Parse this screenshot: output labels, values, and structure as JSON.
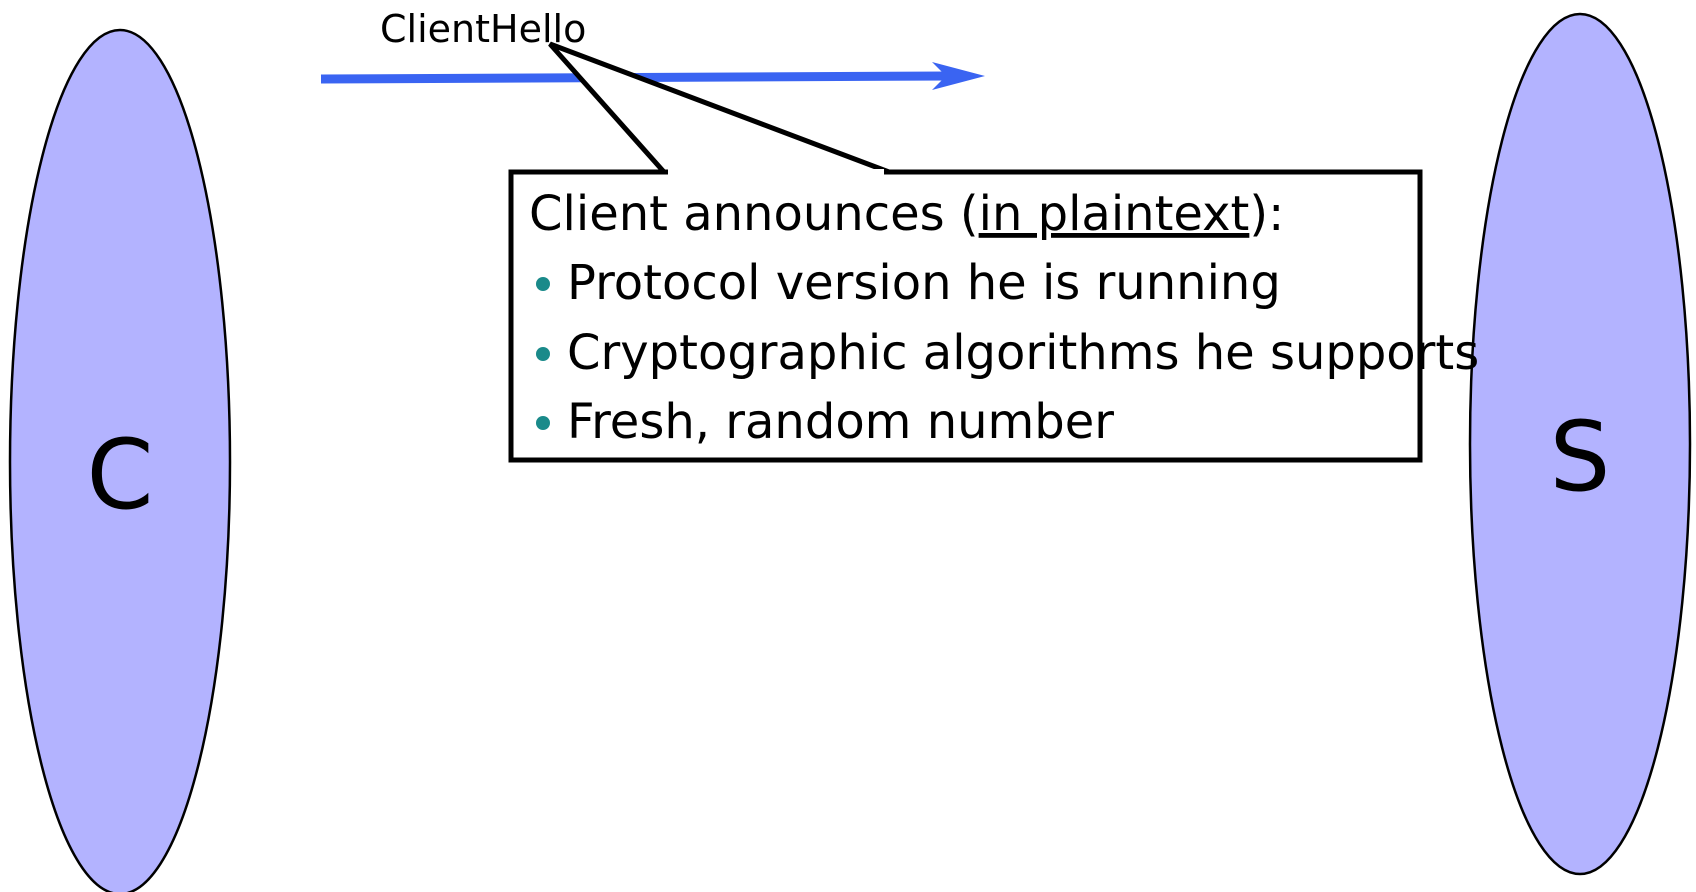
{
  "diagram": {
    "client": {
      "label": "C"
    },
    "server": {
      "label": "S"
    },
    "message": {
      "label": "ClientHello"
    },
    "callout": {
      "heading_prefix": "Client announces (",
      "heading_emphasis": "in plaintext",
      "heading_suffix": "):",
      "bullets": [
        "Protocol version he is running",
        "Cryptographic algorithms he supports",
        "Fresh, random number"
      ]
    }
  },
  "colors": {
    "party_fill": "#b3b3ff",
    "arrow": "#3a64f2",
    "bullet": "#1a8a8a",
    "outline": "#000000"
  }
}
